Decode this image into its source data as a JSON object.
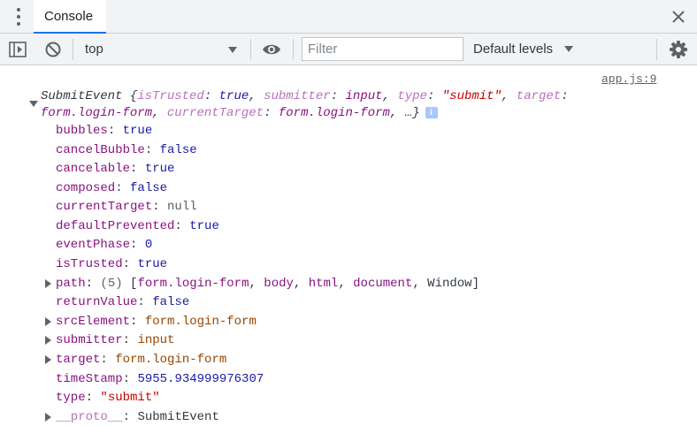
{
  "tab": {
    "label": "Console"
  },
  "toolbar": {
    "context": "top",
    "filter_placeholder": "Filter",
    "levels": "Default levels"
  },
  "log": {
    "source": "app.js:9",
    "summary": {
      "line1": {
        "t1": "SubmitEvent {",
        "k1": "isTrusted",
        "c1": ": ",
        "v1": "true",
        "s1": ", ",
        "k2": "submitter",
        "c2": ": ",
        "v2": "input",
        "s2": ", ",
        "k3": "type",
        "c3": ": ",
        "v3": "\"submit\"",
        "s3": ", ",
        "k4": "target",
        "c4": ":"
      },
      "line2": {
        "v4": "form.login-form",
        "s4": ", ",
        "k5": "currentTarget",
        "c5": ": ",
        "v5": "form.login-form",
        "t2": ", …}"
      },
      "info_badge": "i"
    },
    "props": [
      {
        "key": "bubbles",
        "value": "true"
      },
      {
        "key": "cancelBubble",
        "value": "false"
      },
      {
        "key": "cancelable",
        "value": "true"
      },
      {
        "key": "composed",
        "value": "false"
      },
      {
        "key": "currentTarget",
        "value": "null"
      },
      {
        "key": "defaultPrevented",
        "value": "true"
      },
      {
        "key": "eventPhase",
        "value": "0"
      },
      {
        "key": "isTrusted",
        "value": "true"
      },
      {
        "key": "path",
        "count": "(5)",
        "lb": " [",
        "items": [
          "form.login-form",
          "body",
          "html",
          "document",
          "Window"
        ],
        "sep": ", ",
        "rb": "]"
      },
      {
        "key": "returnValue",
        "value": "false"
      },
      {
        "key": "srcElement",
        "value": "form.login-form"
      },
      {
        "key": "submitter",
        "value": "input"
      },
      {
        "key": "target",
        "value": "form.login-form"
      },
      {
        "key": "timeStamp",
        "value": "5955.934999976307"
      },
      {
        "key": "type",
        "value": "\"submit\""
      },
      {
        "key": "__proto__",
        "value": "SubmitEvent"
      }
    ],
    "colon": ": "
  }
}
